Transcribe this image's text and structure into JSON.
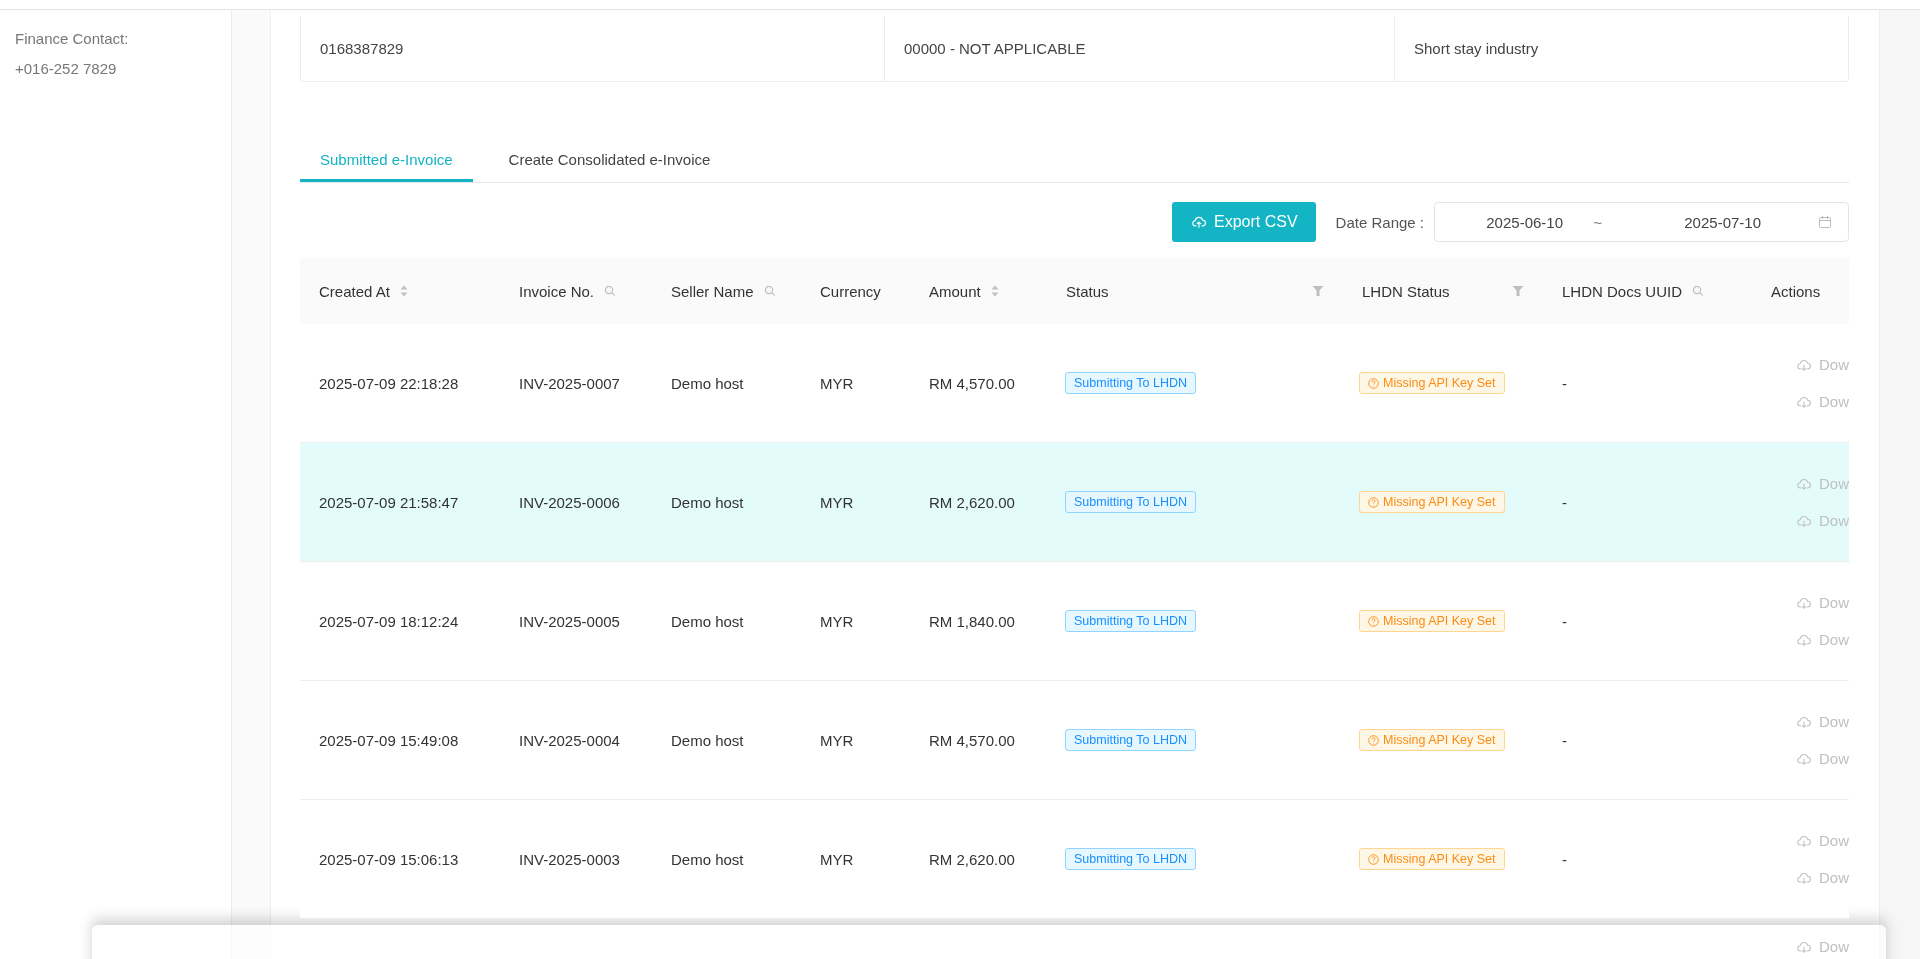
{
  "sidebar": {
    "label": "Finance Contact:",
    "value": "+016-252 7829"
  },
  "info_row": [
    "0168387829",
    "00000 - NOT APPLICABLE",
    "Short stay industry"
  ],
  "tabs": [
    {
      "label": "Submitted e-Invoice",
      "selected": true
    },
    {
      "label": "Create Consolidated e-Invoice",
      "selected": false
    }
  ],
  "toolbar": {
    "export_button": "Export CSV",
    "date_range_label": "Date Range :",
    "start_date": "2025-06-10",
    "separator": "~",
    "end_date": "2025-07-10"
  },
  "table": {
    "columns": [
      {
        "label": "Created At",
        "kind": "sort"
      },
      {
        "label": "Invoice No.",
        "kind": "search"
      },
      {
        "label": "Seller Name",
        "kind": "search"
      },
      {
        "label": "Currency",
        "kind": "plain"
      },
      {
        "label": "Amount",
        "kind": "sort"
      },
      {
        "label": "Status",
        "kind": "filter"
      },
      {
        "label": "LHDN Status",
        "kind": "filter"
      },
      {
        "label": "LHDN Docs UUID",
        "kind": "search"
      },
      {
        "label": "Actions",
        "kind": "plain"
      }
    ],
    "rows": [
      {
        "selected": false,
        "created_at": "2025-07-09 22:18:28",
        "invoice_no": "INV-2025-0007",
        "seller": "Demo host",
        "currency": "MYR",
        "amount": "RM 4,570.00",
        "status": "Submitting To LHDN",
        "lhdn_status": "Missing API Key Set",
        "uuid": "-",
        "actions": [
          "Dow",
          "Dow"
        ]
      },
      {
        "selected": true,
        "created_at": "2025-07-09 21:58:47",
        "invoice_no": "INV-2025-0006",
        "seller": "Demo host",
        "currency": "MYR",
        "amount": "RM 2,620.00",
        "status": "Submitting To LHDN",
        "lhdn_status": "Missing API Key Set",
        "uuid": "-",
        "actions": [
          "Dow",
          "Dow"
        ]
      },
      {
        "selected": false,
        "created_at": "2025-07-09 18:12:24",
        "invoice_no": "INV-2025-0005",
        "seller": "Demo host",
        "currency": "MYR",
        "amount": "RM 1,840.00",
        "status": "Submitting To LHDN",
        "lhdn_status": "Missing API Key Set",
        "uuid": "-",
        "actions": [
          "Dow",
          "Dow"
        ]
      },
      {
        "selected": false,
        "created_at": "2025-07-09 15:49:08",
        "invoice_no": "INV-2025-0004",
        "seller": "Demo host",
        "currency": "MYR",
        "amount": "RM 4,570.00",
        "status": "Submitting To LHDN",
        "lhdn_status": "Missing API Key Set",
        "uuid": "-",
        "actions": [
          "Dow",
          "Dow"
        ]
      },
      {
        "selected": false,
        "created_at": "2025-07-09 15:06:13",
        "invoice_no": "INV-2025-0003",
        "seller": "Demo host",
        "currency": "MYR",
        "amount": "RM 2,620.00",
        "status": "Submitting To LHDN",
        "lhdn_status": "Missing API Key Set",
        "uuid": "-",
        "actions": [
          "Dow",
          "Dow"
        ]
      }
    ],
    "partial_row_actions": [
      "Dow"
    ]
  }
}
